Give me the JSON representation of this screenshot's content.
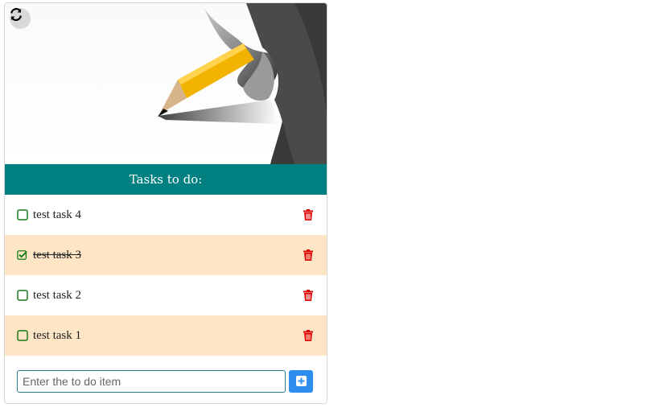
{
  "header": {
    "title": "Tasks to do:"
  },
  "tasks": [
    {
      "label": "test task 4",
      "done": false
    },
    {
      "label": "test task 3",
      "done": true
    },
    {
      "label": "test task 2",
      "done": false
    },
    {
      "label": "test task 1",
      "done": false
    }
  ],
  "add": {
    "placeholder": "Enter the to do item"
  },
  "icons": {
    "refresh": "refresh-icon",
    "checkbox": "square-checkbox-icon",
    "checkbox_checked": "checked-square-icon",
    "trash": "trash-icon",
    "add": "plus-square-icon"
  },
  "colors": {
    "header_bg": "#008080",
    "alt_row_bg": "#fde5c6",
    "checkbox": "#1a7a1a",
    "trash": "#e00000",
    "add_button": "#2e8ef0"
  }
}
